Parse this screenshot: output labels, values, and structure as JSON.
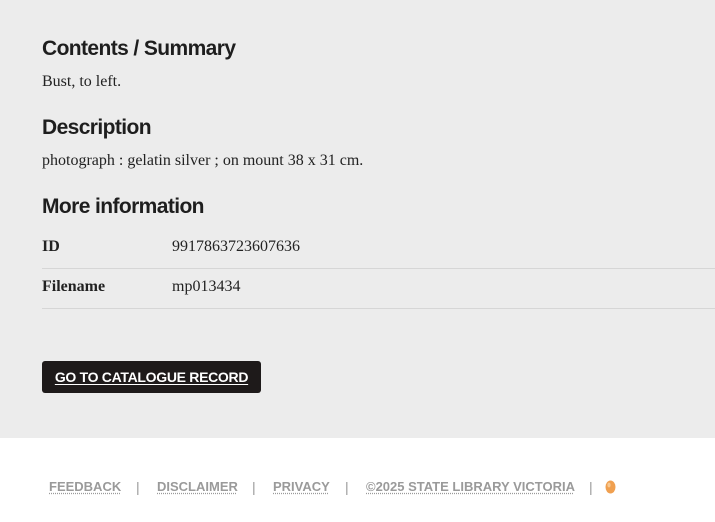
{
  "contents": {
    "heading": "Contents / Summary",
    "text": "Bust, to left."
  },
  "description": {
    "heading": "Description",
    "text": "photograph : gelatin silver ; on mount 38 x 31 cm."
  },
  "more_info": {
    "heading": "More information",
    "rows": [
      {
        "label": "ID",
        "value": "9917863723607636"
      },
      {
        "label": "Filename",
        "value": "mp013434"
      }
    ]
  },
  "catalogue_button": {
    "label": "GO TO CATALOGUE RECORD"
  },
  "footer": {
    "links": [
      "FEEDBACK",
      "DISCLAIMER",
      "PRIVACY",
      "©2025 STATE LIBRARY VICTORIA"
    ],
    "separator": "|",
    "icon": "egg-icon"
  },
  "colors": {
    "main_background": "#ececec",
    "footer_background": "#ffffff",
    "button_background": "#1e1a1a",
    "footer_link": "#9a9a9a",
    "egg_orange": "#f0a050"
  }
}
